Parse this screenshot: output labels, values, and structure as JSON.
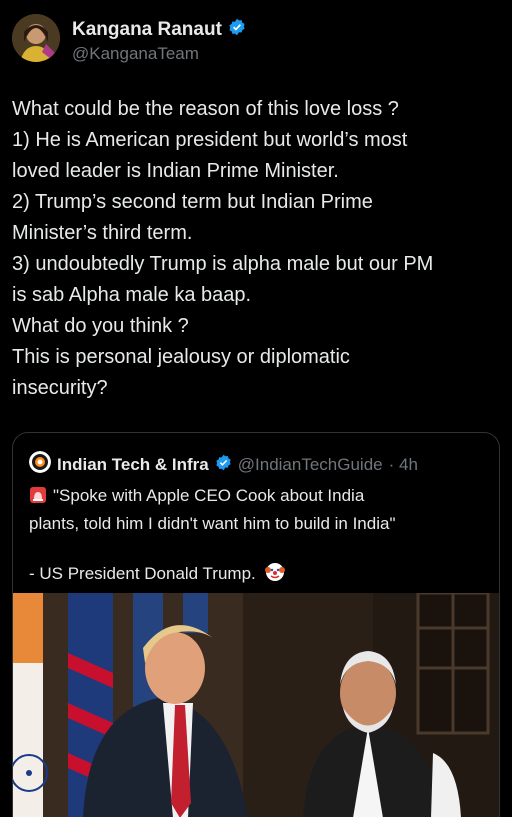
{
  "author": {
    "display_name": "Kangana Ranaut",
    "handle": "@KanganaTeam",
    "verified_icon": "verified-badge-icon"
  },
  "tweet": {
    "lines": [
      "What could be the reason of this love loss ?",
      "1) He is American president but world’s most",
      "loved leader is Indian Prime Minister.",
      "2) Trump’s second term but Indian Prime",
      "Minister’s third term.",
      "3) undoubtedly Trump is alpha male but our PM",
      "is sab Alpha male ka baap.",
      "What do you think ?",
      "This is personal jealousy or diplomatic",
      "insecurity?"
    ]
  },
  "quote": {
    "display_name": "Indian Tech & Infra",
    "handle": "@IndianTechGuide",
    "time": "· 4h",
    "text_lines": [
      "\"Spoke with Apple CEO Cook about India",
      "plants, told him I didn't want him to build in India\""
    ],
    "signature": "- US President Donald Trump.",
    "colors": {
      "accent_blue": "#1d9bf0",
      "text": "#e7e9ea",
      "muted": "#71767b",
      "border": "#2f3336"
    }
  }
}
